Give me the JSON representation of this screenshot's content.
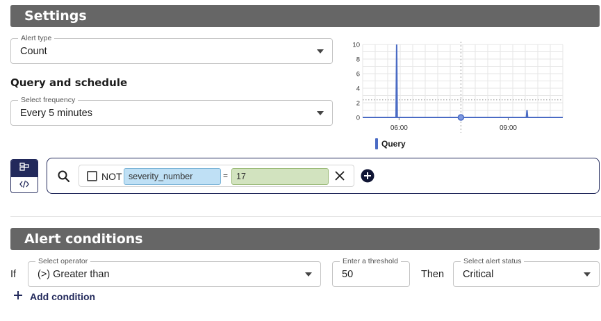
{
  "settings": {
    "title": "Settings"
  },
  "alert_type": {
    "legend": "Alert type",
    "value": "Count"
  },
  "query_schedule": {
    "heading": "Query and schedule",
    "frequency_legend": "Select frequency",
    "frequency_value": "Every 5 minutes"
  },
  "chart_data": {
    "type": "line",
    "title": "",
    "xlabel": "",
    "ylabel": "",
    "x_ticks": [
      "06:00",
      "09:00"
    ],
    "y_ticks": [
      0,
      2,
      4,
      6,
      8,
      10
    ],
    "ylim": [
      0,
      10
    ],
    "threshold_line": 2.4,
    "series": [
      {
        "name": "Query",
        "color": "#4a6bc4",
        "points": [
          {
            "t": "05:00",
            "v": 0
          },
          {
            "t": "05:55",
            "v": 0
          },
          {
            "t": "05:56",
            "v": 10
          },
          {
            "t": "05:57",
            "v": 0
          },
          {
            "t": "09:30",
            "v": 0
          },
          {
            "t": "09:31",
            "v": 1
          },
          {
            "t": "09:32",
            "v": 0
          },
          {
            "t": "10:30",
            "v": 0
          }
        ]
      }
    ],
    "hover_point": {
      "t": "07:42",
      "v": 0
    },
    "legend_position": "bottom-left",
    "grid": true
  },
  "query_bar": {
    "mode_icons": [
      "visual-builder-icon",
      "code-icon"
    ],
    "filter": {
      "not_label": "NOT",
      "field": "severity_number",
      "operator": "=",
      "value": "17"
    }
  },
  "alert_conditions": {
    "title": "Alert conditions",
    "if_label": "If",
    "operator_legend": "Select operator",
    "operator_value": "(>) Greater than",
    "threshold_legend": "Enter a threshold",
    "threshold_value": "50",
    "then_label": "Then",
    "status_legend": "Select alert status",
    "status_value": "Critical",
    "add_condition_label": "Add condition"
  },
  "colors": {
    "accent": "#22295b",
    "header_bg": "#666666",
    "series": "#4a6bc4"
  }
}
